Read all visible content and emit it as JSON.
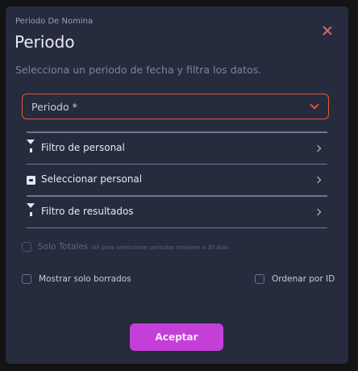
{
  "modal": {
    "eyebrow": "Periodo De Nomina",
    "title": "Periodo",
    "subtitle": "Selecciona un periodo de fecha y filtra los datos."
  },
  "period_select": {
    "label": "Periodo *"
  },
  "menu": {
    "items": [
      {
        "label": "Filtro de personal",
        "icon": "filter-icon"
      },
      {
        "label": "Seleccionar personal",
        "icon": "id-card-icon"
      },
      {
        "label": "Filtro de resultados",
        "icon": "filter-icon"
      }
    ]
  },
  "options": {
    "solo_totales": {
      "label": "Solo Totales",
      "hint": "útil para seleccionar periodos mayores a 30 días",
      "checked": false
    },
    "mostrar_borrados": {
      "label": "Mostrar solo borrados",
      "checked": false
    },
    "ordenar_id": {
      "label": "Ordenar por ID",
      "checked": false
    }
  },
  "actions": {
    "accept_label": "Aceptar"
  },
  "colors": {
    "modal_bg": "#262b3e",
    "accent_orange": "#e45a30",
    "accent_purple": "#c43fd8"
  }
}
